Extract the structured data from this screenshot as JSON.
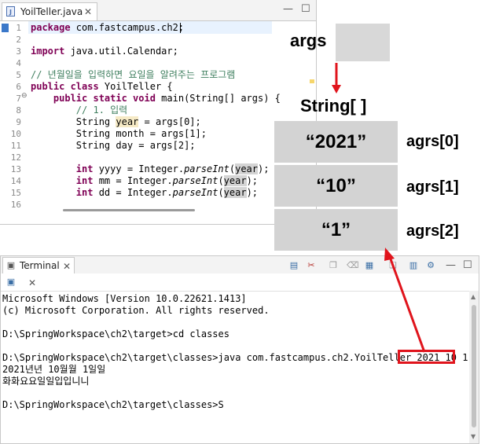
{
  "editor": {
    "tab_label": "YoilTeller.java",
    "tab_icon": "java-file-icon",
    "lines": [
      {
        "num": "1",
        "html": "<span class=\"kw\">package</span> com.fastcampus.ch2;"
      },
      {
        "num": "2",
        "html": ""
      },
      {
        "num": "3",
        "html": "<span class=\"kw\">import</span> java.util.Calendar;"
      },
      {
        "num": "4",
        "html": ""
      },
      {
        "num": "5",
        "html": "<span class=\"cm\">// 년월일을 입력하면 요일을 알려주는 프로그램</span>"
      },
      {
        "num": "6",
        "html": "<span class=\"kw\">public class</span> YoilTeller {"
      },
      {
        "num": "7",
        "html": "    <span class=\"kw\">public static void</span> main(String[] args) {"
      },
      {
        "num": "8",
        "html": "        <span class=\"cm\">// 1. 입력</span>"
      },
      {
        "num": "9",
        "html": "        String <span class=\"hl2\">year</span> = args[0];"
      },
      {
        "num": "10",
        "html": "        String month = args[1];"
      },
      {
        "num": "11",
        "html": "        String day = args[2];"
      },
      {
        "num": "12",
        "html": ""
      },
      {
        "num": "13",
        "html": "        <span class=\"kw\">int</span> yyyy = Integer.<span class=\"sm\">parseInt</span>(<span class=\"hl\">year</span>);"
      },
      {
        "num": "14",
        "html": "        <span class=\"kw\">int</span> mm = Integer.<span class=\"sm\">parseInt</span>(<span class=\"hl\">year</span>);"
      },
      {
        "num": "15",
        "html": "        <span class=\"kw\">int</span> dd = Integer.<span class=\"sm\">parseInt</span>(<span class=\"hl\">year</span>);"
      },
      {
        "num": "16",
        "html": ""
      }
    ]
  },
  "diagram": {
    "args_label": "args",
    "array_label": "String[ ]",
    "cells": [
      "“2021”",
      "“10”",
      "“1”"
    ],
    "cell_labels": [
      "agrs[0]",
      "agrs[1]",
      "agrs[2]"
    ],
    "arrow_color": "#e0141c"
  },
  "terminal": {
    "tab_label": "Terminal",
    "lines": [
      "Microsoft Windows [Version 10.0.22621.1413]",
      "(c) Microsoft Corporation. All rights reserved.",
      "",
      "D:\\SpringWorkspace\\ch2\\target>cd classes",
      "",
      "D:\\SpringWorkspace\\ch2\\target\\classes>java com.fastcampus.ch2.YoilTeller 2021 10 1",
      "2021년년 10월월 1일일",
      "화화요요일일입입니니",
      "",
      "D:\\SpringWorkspace\\ch2\\target\\classes>S"
    ],
    "highlighted_args": "2021 10 1"
  },
  "colors": {
    "keyword": "#7f0055",
    "comment": "#3f7f5f",
    "highlight_red": "#e0141c",
    "cell_gray": "#d3d3d3"
  }
}
